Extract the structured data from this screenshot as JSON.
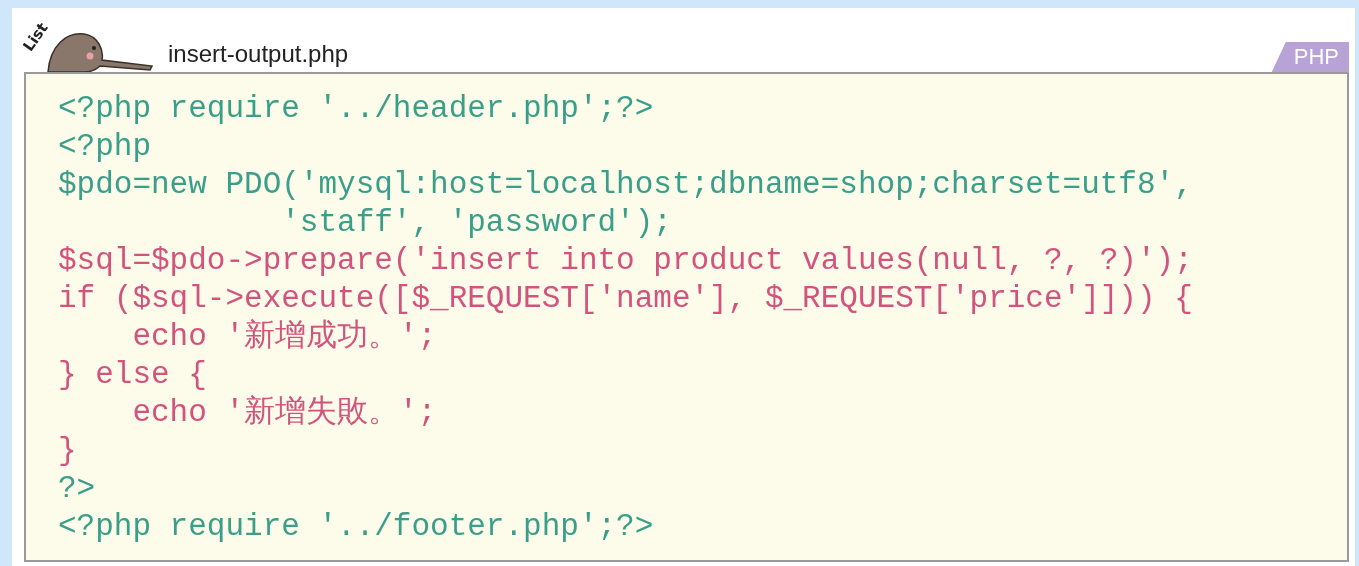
{
  "listing": {
    "badge": "List",
    "filename": "insert-output.php",
    "language": "PHP",
    "lines": [
      {
        "text": "<?php require '../header.php';?>",
        "kind": "plain"
      },
      {
        "text": "<?php",
        "kind": "plain"
      },
      {
        "text": "$pdo=new PDO('mysql:host=localhost;dbname=shop;charset=utf8',",
        "kind": "plain"
      },
      {
        "text": "            'staff', 'password');",
        "kind": "plain"
      },
      {
        "text": "$sql=$pdo->prepare('insert into product values(null, ?, ?)');",
        "kind": "highlight"
      },
      {
        "text": "if ($sql->execute([$_REQUEST['name'], $_REQUEST['price']])) {",
        "kind": "highlight"
      },
      {
        "text": "    echo '新增成功。';",
        "kind": "highlight"
      },
      {
        "text": "} else {",
        "kind": "highlight"
      },
      {
        "text": "    echo '新增失敗。';",
        "kind": "highlight"
      },
      {
        "text": "}",
        "kind": "highlight"
      },
      {
        "text": "?>",
        "kind": "plain"
      },
      {
        "text": "<?php require '../footer.php';?>",
        "kind": "plain"
      }
    ]
  }
}
